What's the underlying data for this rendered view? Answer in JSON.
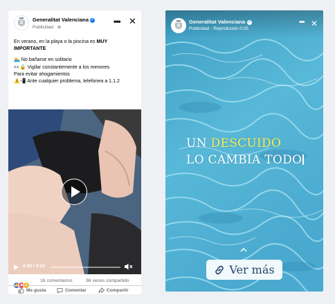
{
  "post": {
    "page_name": "Generalitat Valenciana",
    "meta": "Publicidad · ",
    "more_label": "•••",
    "close_label": "✕",
    "text": {
      "intro": "En verano, en la playa o la piscina es ",
      "intro_bold": "MUY IMPORTANTE",
      "line1": "🏊 No bañarse en solitario",
      "line2": "👀🔒 Vigilar constantemente a los menores",
      "line3": "Para evitar ahogamientos",
      "line4": "⚠️📲 Ante cualquier problema, telefonea a 1.1.2"
    },
    "video": {
      "time": "0:00 / 0:25",
      "progress": 0.0
    },
    "reactions": {
      "icons": [
        "like-icon",
        "love-icon",
        "wow-icon"
      ],
      "comments": "16 comentarios",
      "shares": "36 veces compartido"
    },
    "actions": {
      "like": "Me gusta",
      "comment": "Comentar",
      "share": "Compartir"
    }
  },
  "story": {
    "page_name": "Generalitat Valenciana",
    "meta": "Publicidad · Reproducido 0:25",
    "more_label": "•••",
    "close_label": "✕",
    "headline_prefix": "UN ",
    "headline_highlight": "DESCUIDO",
    "headline_line2": "LO CAMBIA TODO",
    "cta_label": "Ver más"
  },
  "colors": {
    "brand_blue": "#1877f2",
    "highlight_yellow": "#f8ef50",
    "cta_text": "#23446b"
  }
}
